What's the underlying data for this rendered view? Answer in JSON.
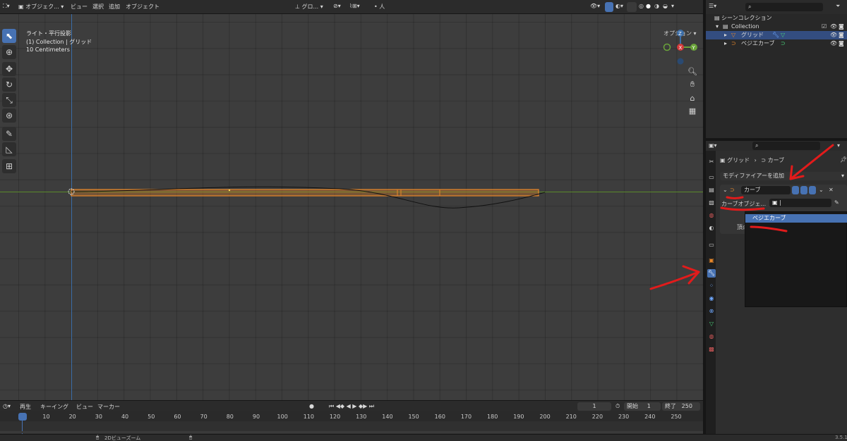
{
  "header": {
    "mode": "オブジェク...",
    "menus": [
      "ビュー",
      "選択",
      "追加",
      "オブジェクト"
    ],
    "transform": "グロ...",
    "options": "オプション"
  },
  "overlay": {
    "line1": "ライト・平行投影",
    "line2": "(1) Collection | グリッド",
    "line3": "10 Centimeters"
  },
  "gizmo": {
    "z": "Z",
    "x": "X",
    "y": "Y"
  },
  "timeline": {
    "menus": [
      "再生",
      "キーイング",
      "ビュー",
      "マーカー"
    ],
    "current_frame": "1",
    "start_label": "開始",
    "start": "1",
    "end_label": "終了",
    "end": "250",
    "ticks": [
      "1",
      "10",
      "20",
      "30",
      "40",
      "50",
      "60",
      "70",
      "80",
      "90",
      "100",
      "110",
      "120",
      "130",
      "140",
      "150",
      "160",
      "170",
      "180",
      "190",
      "200",
      "210",
      "220",
      "230",
      "240",
      "250"
    ]
  },
  "status": {
    "hint": "2Dビューズーム",
    "version": "3.5.1"
  },
  "outliner": {
    "scene_collection": "シーンコレクション",
    "collection": "Collection",
    "items": [
      "グリッド",
      "ベジエカーブ"
    ]
  },
  "properties": {
    "breadcrumb_object": "グリッド",
    "breadcrumb_modifier": "カーブ",
    "add_modifier": "モディファイアーを追加",
    "modifier_name": "カーブ",
    "curve_object_label": "カーブオブジェ...",
    "vertex_label": "頂点",
    "dropdown_item": "ベジエカーブ"
  },
  "colors": {
    "accent": "#4772b3",
    "selected_object": "#e8882a",
    "x_axis": "#5a8a2a"
  }
}
